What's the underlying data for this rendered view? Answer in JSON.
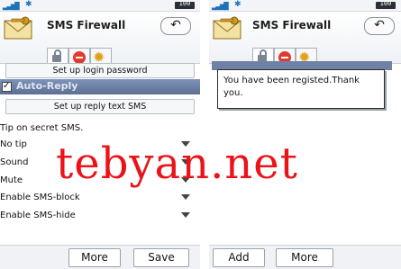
{
  "status": {
    "battery_label": "100"
  },
  "left": {
    "title": "SMS Firewall",
    "buttons": {
      "login": "Set up login password",
      "reply_text": "Set up reply text SMS"
    },
    "auto_reply": {
      "label": "Auto-Reply",
      "checked": true
    },
    "options": [
      {
        "label": "Tip on secret SMS."
      },
      {
        "label": "No tip",
        "dropdown": true
      },
      {
        "label": "Sound",
        "dropdown": true
      },
      {
        "label": "Mute",
        "dropdown": true
      },
      {
        "label": "Enable SMS-block",
        "dropdown": true
      },
      {
        "label": "Enable SMS-hide",
        "dropdown": true
      }
    ],
    "softkeys": {
      "left": "More",
      "right": "Save"
    }
  },
  "right": {
    "title": "SMS Firewall",
    "dialog_text": "You have been registed.Thank you.",
    "softkeys": {
      "left": "Add",
      "right": "More"
    }
  },
  "watermark": "tebyan.net",
  "colors": {
    "section_bar": "#6a7da3",
    "watermark": "#ea1418",
    "stop_icon": "#e23a2e",
    "gear_icon": "#e0a21a"
  },
  "icons": [
    "envelope-key-icon",
    "lock-icon",
    "stop-icon",
    "gear-icon",
    "back-arrow-icon",
    "signal-icon",
    "bluetooth-icon",
    "battery-icon"
  ]
}
